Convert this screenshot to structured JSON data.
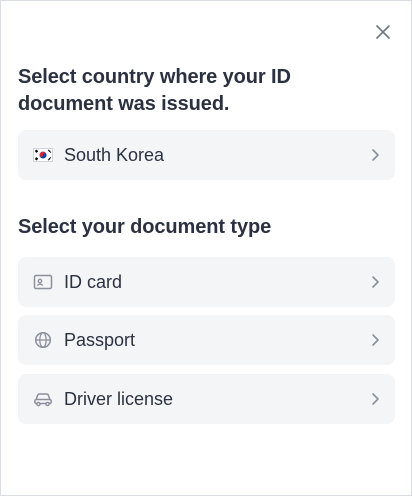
{
  "modal": {
    "close_icon": "close-icon",
    "country_heading": "Select country where your ID document was issued.",
    "country": {
      "label": "South Korea",
      "flag_icon": "south-korea-flag-icon"
    },
    "doctype_heading": "Select your document type",
    "document_types": [
      {
        "label": "ID card",
        "icon": "id-card-icon"
      },
      {
        "label": "Passport",
        "icon": "globe-icon"
      },
      {
        "label": "Driver license",
        "icon": "car-icon"
      }
    ],
    "chevron_icon": "chevron-right-icon"
  },
  "colors": {
    "option_bg": "#f4f5f7",
    "text": "#2b3140",
    "icon": "#8a909c"
  }
}
